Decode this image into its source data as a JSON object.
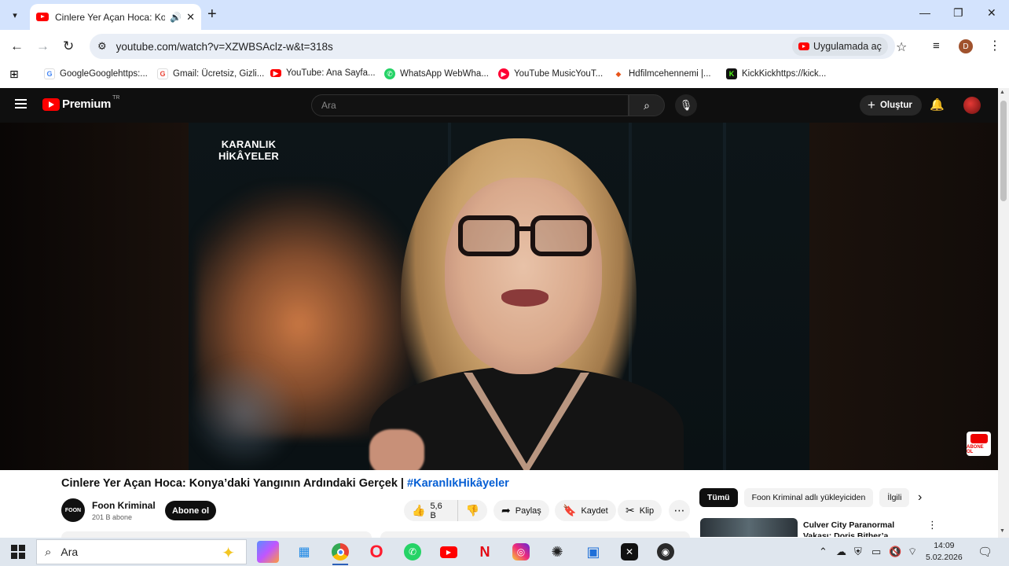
{
  "browser": {
    "tab": {
      "title": "Cinlere Yer Açan Hoca: Konya",
      "audio_icon": "speaker-icon",
      "close_glyph": "✕"
    },
    "new_tab_glyph": "+",
    "window_controls": {
      "minimize": "—",
      "maximize": "❐",
      "close": "✕"
    },
    "address": "youtube.com/watch?v=XZWBSAclz-w&t=318s",
    "open_in_app": "Uygulamada aç",
    "profile_initial": "D",
    "bookmarks": [
      {
        "label": "GoogleGooglehttps:...",
        "icon": "google-icon",
        "color": "#4285f4"
      },
      {
        "label": "Gmail: Ücretsiz, Gizli...",
        "icon": "google-icon",
        "color": "#ea4335"
      },
      {
        "label": "YouTube: Ana Sayfa...",
        "icon": "youtube-icon",
        "color": "#ff0000"
      },
      {
        "label": "WhatsApp WebWha...",
        "icon": "whatsapp-icon",
        "color": "#25d366"
      },
      {
        "label": "YouTube MusicYouT...",
        "icon": "youtube-music-icon",
        "color": "#ff0033"
      },
      {
        "label": "Hdfilmcehennemi |...",
        "icon": "hdfilm-icon",
        "color": "#e8541a"
      },
      {
        "label": "KickKickhttps://kick...",
        "icon": "kick-icon",
        "color": "#53fc18"
      }
    ]
  },
  "youtube": {
    "logo_text": "Premium",
    "logo_region": "TR",
    "search_placeholder": "Ara",
    "create_label": "Oluştur",
    "video": {
      "brand_line1": "KARANLIK",
      "brand_line2": "HİKÂYELER",
      "badge_text": "ABONE OL"
    },
    "title_main": "Cinlere Yer Açan Hoca: Konya’daki Yangının Ardındaki Gerçek | ",
    "title_hashtag": "#KaranlıkHikâyeler",
    "channel": {
      "avatar_text": "FOON",
      "name": "Foon Kriminal",
      "subscribers": "201 B abone",
      "subscribe_label": "Abone ol"
    },
    "actions": {
      "likes": "5,6 B",
      "share": "Paylaş",
      "save": "Kaydet",
      "clip": "Klip"
    },
    "chips": [
      "Tümü",
      "Foon Kriminal adlı yükleyiciden",
      "İlgili"
    ],
    "recommendation": {
      "title": "Culver City Paranormal Vakası: Doris Bither’a Musallat Olan..."
    }
  },
  "taskbar": {
    "search_label": "Ara",
    "apps": [
      "copilot-icon",
      "file-explorer-icon",
      "chrome-icon",
      "opera-icon",
      "whatsapp-icon",
      "youtube-icon",
      "netflix-icon",
      "instagram-icon",
      "chatgpt-icon",
      "store-icon",
      "capcut-icon",
      "obs-icon"
    ],
    "time": "14:09",
    "date": "5.02.2026"
  }
}
